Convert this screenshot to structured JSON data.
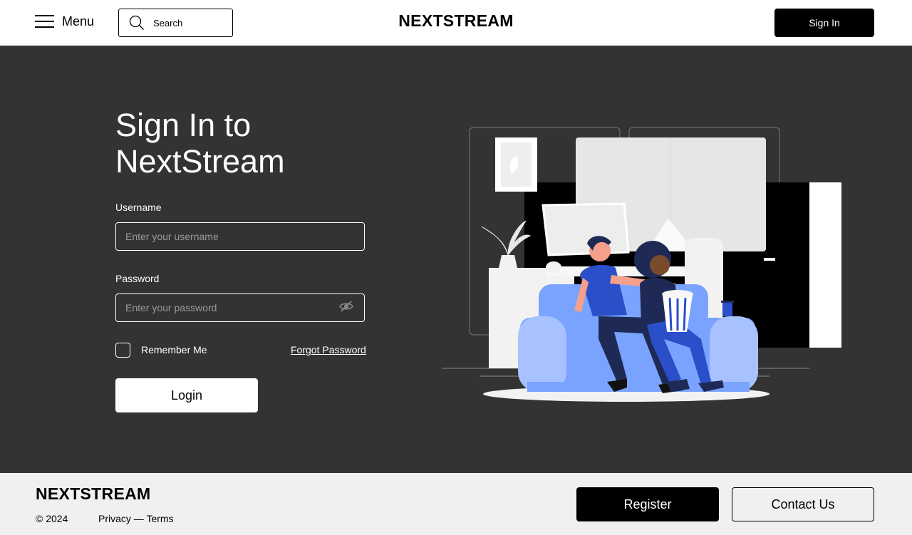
{
  "header": {
    "menu_label": "Menu",
    "menu_icon": "hamburger-menu-icon",
    "search_label": "Search",
    "search_icon": "search-icon",
    "brand": "NEXTSTREAM",
    "sign_in_label": "Sign In"
  },
  "login": {
    "title": "Sign In to NextStream",
    "username_label": "Username",
    "username_placeholder": "Enter your username",
    "password_label": "Password",
    "password_placeholder": "Enter your password",
    "password_toggle_icon": "eye-slash-icon",
    "remember_me_label": "Remember Me",
    "forgot_password_label": "Forgot Password",
    "login_label": "Login"
  },
  "footer": {
    "brand": "NEXTSTREAM",
    "copyright": "© 2024",
    "legal_links": [
      "Privacy",
      "Terms"
    ],
    "legal_separator": "—",
    "register_label": "Register",
    "contact_label": "Contact Us"
  },
  "colors": {
    "main_bg": "#333333",
    "footer_bg": "#f0f0f0",
    "accent_blue": "#7aa3ff",
    "dark_blue": "#2b4fc9",
    "black": "#000000",
    "white": "#ffffff"
  }
}
